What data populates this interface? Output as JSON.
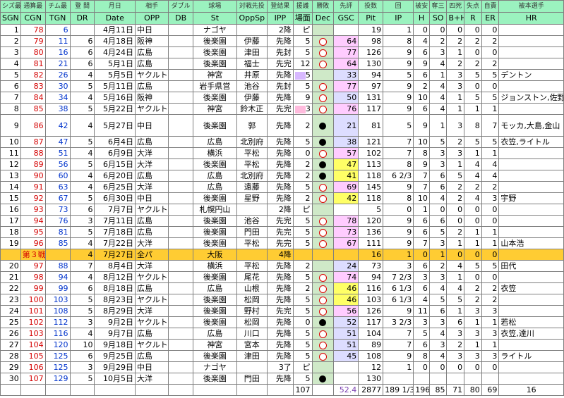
{
  "header_sub": [
    "シズ最",
    "通算最",
    "チム最",
    "登 間",
    "月日",
    "相手",
    "ダブル",
    "球場",
    "対戦先投",
    "登結果",
    "援護",
    "勝敗",
    "先評",
    "投数",
    "回",
    "被安",
    "奪三",
    "四死",
    "失点",
    "自責",
    "被本選手"
  ],
  "header_main": [
    "SGN",
    "CGN",
    "TGN",
    "DR",
    "Date",
    "OPP",
    "DB",
    "St",
    "OppSp",
    "IPP",
    "場面",
    "Dec",
    "GSC",
    "Pit",
    "IP",
    "H",
    "SO",
    "B+H",
    "R",
    "ER",
    "HR"
  ],
  "rows": [
    {
      "sgn": "1",
      "cgn": "78",
      "tgn": "6",
      "dr": "",
      "date": "4月11日",
      "opp": "中日",
      "db": "",
      "st": "ナゴヤ",
      "oppsp": "",
      "ipp": "2降",
      "scene": "ピ",
      "dec": "",
      "gsc": "",
      "pit": "19",
      "ip": "1",
      "h": "0",
      "so": "0",
      "bh": "0",
      "r": "0",
      "er": "0",
      "hr": "",
      "box": "",
      "gscc": ""
    },
    {
      "sgn": "2",
      "cgn": "79",
      "tgn": "11",
      "dr": "6",
      "date": "4月18日",
      "opp": "阪神",
      "db": "",
      "st": "後楽園",
      "oppsp": "伊藤",
      "ipp": "先降",
      "scene": "5",
      "dec": "o",
      "gsc": "64",
      "pit": "98",
      "ip": "8",
      "h": "4",
      "so": "2",
      "bh": "2",
      "r": "2",
      "er": "2",
      "hr": "",
      "box": "",
      "gscc": "pink"
    },
    {
      "sgn": "3",
      "cgn": "80",
      "tgn": "16",
      "dr": "6",
      "date": "4月24日",
      "opp": "広島",
      "db": "",
      "st": "後楽園",
      "oppsp": "津田",
      "ipp": "先封",
      "scene": "5",
      "dec": "o",
      "gsc": "77",
      "pit": "126",
      "ip": "9",
      "h": "6",
      "so": "3",
      "bh": "1",
      "r": "0",
      "er": "0",
      "hr": "",
      "box": "",
      "gscc": "pink"
    },
    {
      "sgn": "4",
      "cgn": "81",
      "tgn": "21",
      "dr": "6",
      "date": "5月1日",
      "opp": "広島",
      "db": "",
      "st": "後楽園",
      "oppsp": "福士",
      "ipp": "先完",
      "scene": "12",
      "dec": "o",
      "gsc": "64",
      "pit": "130",
      "ip": "9",
      "h": "9",
      "so": "4",
      "bh": "2",
      "r": "2",
      "er": "2",
      "hr": "",
      "box": "",
      "gscc": "pink"
    },
    {
      "sgn": "5",
      "cgn": "82",
      "tgn": "26",
      "dr": "4",
      "date": "5月5日",
      "opp": "ヤクルト",
      "db": "",
      "st": "神宮",
      "oppsp": "井原",
      "ipp": "先降",
      "scene": "5",
      "dec": "",
      "gsc": "33",
      "pit": "94",
      "ip": "5",
      "h": "6",
      "so": "1",
      "bh": "3",
      "r": "5",
      "er": "5",
      "hr": "デントン",
      "box": "lav",
      "gscc": "lav"
    },
    {
      "sgn": "6",
      "cgn": "83",
      "tgn": "30",
      "dr": "5",
      "date": "5月11日",
      "opp": "広島",
      "db": "",
      "st": "岩手県営",
      "oppsp": "池谷",
      "ipp": "先封",
      "scene": "5",
      "dec": "o",
      "gsc": "77",
      "pit": "97",
      "ip": "9",
      "h": "2",
      "so": "4",
      "bh": "3",
      "r": "0",
      "er": "0",
      "hr": "",
      "box": "",
      "gscc": "pink"
    },
    {
      "sgn": "7",
      "cgn": "84",
      "tgn": "34",
      "dr": "4",
      "date": "5月16日",
      "opp": "阪神",
      "db": "",
      "st": "後楽園",
      "oppsp": "伊藤",
      "ipp": "先降",
      "scene": "9",
      "dec": "o",
      "gsc": "50",
      "pit": "131",
      "ip": "9",
      "h": "10",
      "so": "4",
      "bh": "1",
      "r": "5",
      "er": "5",
      "hr": "ジョンストン,佐野",
      "box": "",
      "gscc": "lav"
    },
    {
      "sgn": "8",
      "cgn": "85",
      "tgn": "38",
      "dr": "5",
      "date": "5月22日",
      "opp": "ヤクルト",
      "db": "",
      "st": "神宮",
      "oppsp": "鈴木正",
      "ipp": "先完",
      "scene": "3",
      "dec": "o",
      "gsc": "76",
      "pit": "117",
      "ip": "9",
      "h": "6",
      "so": "4",
      "bh": "1",
      "r": "1",
      "er": "1",
      "hr": "",
      "box": "pink",
      "gscc": "pink"
    },
    {
      "sgn": "9",
      "cgn": "86",
      "tgn": "42",
      "dr": "4",
      "date": "5月27日",
      "opp": "中日",
      "db": "",
      "st": "後楽園",
      "oppsp": "郭",
      "ipp": "先降",
      "scene": "2",
      "dec": "x",
      "gsc": "21",
      "pit": "81",
      "ip": "5",
      "h": "9",
      "so": "1",
      "bh": "3",
      "r": "8",
      "er": "7",
      "hr": "モッカ,大島,金山",
      "box": "",
      "gscc": "lav",
      "tall": true
    },
    {
      "sgn": "10",
      "cgn": "87",
      "tgn": "47",
      "dr": "5",
      "date": "6月4日",
      "opp": "広島",
      "db": "",
      "st": "広島",
      "oppsp": "北別府",
      "ipp": "先降",
      "scene": "5",
      "dec": "x",
      "gsc": "38",
      "pit": "121",
      "ip": "7",
      "h": "10",
      "so": "5",
      "bh": "2",
      "r": "5",
      "er": "5",
      "hr": "衣笠,ライトル",
      "box": "",
      "gscc": "lav"
    },
    {
      "sgn": "11",
      "cgn": "88",
      "tgn": "51",
      "dr": "4",
      "date": "6月9日",
      "opp": "大洋",
      "db": "",
      "st": "横浜",
      "oppsp": "平松",
      "ipp": "先降",
      "scene": "0",
      "dec": "o",
      "gsc": "57",
      "pit": "102",
      "ip": "7",
      "h": "8",
      "so": "3",
      "bh": "3",
      "r": "1",
      "er": "1",
      "hr": "",
      "box": "",
      "gscc": "pink"
    },
    {
      "sgn": "12",
      "cgn": "89",
      "tgn": "56",
      "dr": "5",
      "date": "6月15日",
      "opp": "大洋",
      "db": "",
      "st": "後楽園",
      "oppsp": "平松",
      "ipp": "先降",
      "scene": "2",
      "dec": "x",
      "gsc": "47",
      "pit": "113",
      "ip": "8",
      "h": "9",
      "so": "3",
      "bh": "1",
      "r": "4",
      "er": "4",
      "hr": "",
      "box": "",
      "gscc": "yel"
    },
    {
      "sgn": "13",
      "cgn": "90",
      "tgn": "60",
      "dr": "4",
      "date": "6月20日",
      "opp": "広島",
      "db": "",
      "st": "広島",
      "oppsp": "北別府",
      "ipp": "先降",
      "scene": "2",
      "dec": "x",
      "gsc": "41",
      "pit": "118",
      "ip": "6 2/3",
      "h": "7",
      "so": "6",
      "bh": "5",
      "r": "4",
      "er": "4",
      "hr": "",
      "box": "",
      "gscc": "yel"
    },
    {
      "sgn": "14",
      "cgn": "91",
      "tgn": "63",
      "dr": "4",
      "date": "6月25日",
      "opp": "大洋",
      "db": "",
      "st": "広島",
      "oppsp": "遠藤",
      "ipp": "先降",
      "scene": "5",
      "dec": "o",
      "gsc": "69",
      "pit": "145",
      "ip": "9",
      "h": "7",
      "so": "6",
      "bh": "2",
      "r": "2",
      "er": "2",
      "hr": "",
      "box": "",
      "gscc": "pink"
    },
    {
      "sgn": "15",
      "cgn": "92",
      "tgn": "67",
      "dr": "5",
      "date": "6月30日",
      "opp": "中日",
      "db": "",
      "st": "後楽園",
      "oppsp": "星野",
      "ipp": "先降",
      "scene": "2",
      "dec": "o",
      "gsc": "42",
      "pit": "118",
      "ip": "8",
      "h": "10",
      "so": "4",
      "bh": "2",
      "r": "4",
      "er": "3",
      "hr": "宇野",
      "box": "",
      "gscc": "yel"
    },
    {
      "sgn": "16",
      "cgn": "93",
      "tgn": "73",
      "dr": "6",
      "date": "7月7日",
      "opp": "ヤクルト",
      "db": "",
      "st": "札幌円山",
      "oppsp": "",
      "ipp": "2降",
      "scene": "ピ",
      "dec": "",
      "gsc": "",
      "pit": "5",
      "ip": "0",
      "h": "1",
      "so": "0",
      "bh": "0",
      "r": "0",
      "er": "0",
      "hr": "",
      "box": "",
      "gscc": ""
    },
    {
      "sgn": "17",
      "cgn": "94",
      "tgn": "76",
      "dr": "3",
      "date": "7月11日",
      "opp": "広島",
      "db": "",
      "st": "後楽園",
      "oppsp": "池谷",
      "ipp": "先完",
      "scene": "5",
      "dec": "o",
      "gsc": "78",
      "pit": "120",
      "ip": "9",
      "h": "6",
      "so": "6",
      "bh": "0",
      "r": "0",
      "er": "0",
      "hr": "",
      "box": "",
      "gscc": "pink"
    },
    {
      "sgn": "18",
      "cgn": "95",
      "tgn": "81",
      "dr": "5",
      "date": "7月18日",
      "opp": "広島",
      "db": "",
      "st": "後楽園",
      "oppsp": "門田",
      "ipp": "先完",
      "scene": "5",
      "dec": "o",
      "gsc": "73",
      "pit": "136",
      "ip": "9",
      "h": "6",
      "so": "5",
      "bh": "2",
      "r": "1",
      "er": "1",
      "hr": "",
      "box": "",
      "gscc": "pink"
    },
    {
      "sgn": "19",
      "cgn": "96",
      "tgn": "85",
      "dr": "4",
      "date": "7月22日",
      "opp": "大洋",
      "db": "",
      "st": "後楽園",
      "oppsp": "平松",
      "ipp": "先完",
      "scene": "5",
      "dec": "o",
      "gsc": "67",
      "pit": "111",
      "ip": "9",
      "h": "7",
      "so": "3",
      "bh": "1",
      "r": "1",
      "er": "1",
      "hr": "山本浩",
      "box": "",
      "gscc": "pink"
    },
    {
      "allstar": true,
      "sgn": "",
      "cgn": "第３戦",
      "tgn": "",
      "dr": "4",
      "date": "7月27日",
      "opp": "全パ",
      "db": "",
      "st": "大阪",
      "oppsp": "",
      "ipp": "4降",
      "scene": "",
      "dec": "",
      "gsc": "",
      "pit": "16",
      "ip": "1",
      "h": "0",
      "so": "1",
      "bh": "0",
      "r": "0",
      "er": "0",
      "hr": "",
      "box": "",
      "gscc": ""
    },
    {
      "sgn": "20",
      "cgn": "97",
      "tgn": "88",
      "dr": "7",
      "date": "8月4日",
      "opp": "大洋",
      "db": "",
      "st": "横浜",
      "oppsp": "平松",
      "ipp": "先降",
      "scene": "2",
      "dec": "",
      "gsc": "24",
      "pit": "73",
      "ip": "3",
      "h": "6",
      "so": "2",
      "bh": "4",
      "r": "5",
      "er": "5",
      "hr": "田代",
      "box": "",
      "gscc": "lav"
    },
    {
      "sgn": "21",
      "cgn": "98",
      "tgn": "94",
      "dr": "4",
      "date": "8月12日",
      "opp": "ヤクルト",
      "db": "",
      "st": "後楽園",
      "oppsp": "尾花",
      "ipp": "先降",
      "scene": "5",
      "dec": "o",
      "gsc": "74",
      "pit": "94",
      "ip": "7 2/3",
      "h": "3",
      "so": "3",
      "bh": "1",
      "r": "0",
      "er": "0",
      "hr": "",
      "box": "",
      "gscc": "pink"
    },
    {
      "sgn": "22",
      "cgn": "99",
      "tgn": "99",
      "dr": "6",
      "date": "8月18日",
      "opp": "広島",
      "db": "",
      "st": "広島",
      "oppsp": "山根",
      "ipp": "先降",
      "scene": "2",
      "dec": "o",
      "gsc": "46",
      "pit": "116",
      "ip": "6 1/3",
      "h": "6",
      "so": "4",
      "bh": "4",
      "r": "2",
      "er": "2",
      "hr": "衣笠",
      "box": "",
      "gscc": "yel"
    },
    {
      "sgn": "23",
      "cgn": "100",
      "tgn": "103",
      "dr": "5",
      "date": "8月23日",
      "opp": "ヤクルト",
      "db": "",
      "st": "後楽園",
      "oppsp": "松岡",
      "ipp": "先降",
      "scene": "5",
      "dec": "o",
      "gsc": "46",
      "pit": "103",
      "ip": "6 1/3",
      "h": "4",
      "so": "5",
      "bh": "5",
      "r": "2",
      "er": "2",
      "hr": "",
      "box": "",
      "gscc": "yel"
    },
    {
      "sgn": "24",
      "cgn": "101",
      "tgn": "108",
      "dr": "5",
      "date": "8月29日",
      "opp": "大洋",
      "db": "",
      "st": "後楽園",
      "oppsp": "野村",
      "ipp": "先完",
      "scene": "5",
      "dec": "o",
      "gsc": "56",
      "pit": "126",
      "ip": "9",
      "h": "11",
      "so": "6",
      "bh": "1",
      "r": "3",
      "er": "3",
      "hr": "",
      "box": "",
      "gscc": "pink"
    },
    {
      "sgn": "25",
      "cgn": "102",
      "tgn": "112",
      "dr": "3",
      "date": "9月2日",
      "opp": "ヤクルト",
      "db": "",
      "st": "後楽園",
      "oppsp": "松岡",
      "ipp": "先降",
      "scene": "0",
      "dec": "x",
      "gsc": "52",
      "pit": "117",
      "ip": "3 2/3",
      "h": "3",
      "so": "3",
      "bh": "6",
      "r": "1",
      "er": "1",
      "hr": "若松",
      "box": "",
      "gscc": "lav"
    },
    {
      "sgn": "26",
      "cgn": "103",
      "tgn": "116",
      "dr": "4",
      "date": "9月7日",
      "opp": "広島",
      "db": "",
      "st": "広島",
      "oppsp": "川口",
      "ipp": "先降",
      "scene": "5",
      "dec": "o",
      "gsc": "51",
      "pit": "104",
      "ip": "7",
      "h": "5",
      "so": "4",
      "bh": "3",
      "r": "3",
      "er": "3",
      "hr": "衣笠,達川",
      "box": "",
      "gscc": "lav"
    },
    {
      "sgn": "27",
      "cgn": "104",
      "tgn": "120",
      "dr": "10",
      "date": "9月18日",
      "opp": "ヤクルト",
      "db": "",
      "st": "神宮",
      "oppsp": "宮本",
      "ipp": "先降",
      "scene": "5",
      "dec": "o",
      "gsc": "51",
      "pit": "89",
      "ip": "7",
      "h": "6",
      "so": "3",
      "bh": "2",
      "r": "1",
      "er": "1",
      "hr": "",
      "box": "",
      "gscc": "lav"
    },
    {
      "sgn": "28",
      "cgn": "105",
      "tgn": "125",
      "dr": "6",
      "date": "9月25日",
      "opp": "広島",
      "db": "",
      "st": "後楽園",
      "oppsp": "津田",
      "ipp": "先降",
      "scene": "5",
      "dec": "o",
      "gsc": "45",
      "pit": "108",
      "ip": "9",
      "h": "8",
      "so": "4",
      "bh": "3",
      "r": "3",
      "er": "3",
      "hr": "ライトル",
      "box": "",
      "gscc": "lav"
    },
    {
      "sgn": "29",
      "cgn": "106",
      "tgn": "125",
      "dr": "3",
      "date": "9月29日",
      "opp": "中日",
      "db": "",
      "st": "ナゴヤ",
      "oppsp": "",
      "ipp": "3了",
      "scene": "ピ",
      "dec": "",
      "gsc": "",
      "pit": "12",
      "ip": "1",
      "h": "0",
      "so": "0",
      "bh": "0",
      "r": "0",
      "er": "0",
      "hr": "",
      "box": "",
      "gscc": ""
    },
    {
      "sgn": "30",
      "cgn": "107",
      "tgn": "129",
      "dr": "5",
      "date": "10月5日",
      "opp": "大洋",
      "db": "",
      "st": "後楽園",
      "oppsp": "門田",
      "ipp": "先降",
      "scene": "5",
      "dec": "x",
      "gsc": "",
      "pit": "130",
      "ip": "",
      "h": "",
      "so": "",
      "bh": "",
      "r": "",
      "er": "",
      "hr": "",
      "box": "",
      "gscc": ""
    }
  ],
  "totals": {
    "scene": "107",
    "gsc": "52.4",
    "pit": "2877",
    "ip": "189 1/3",
    "h": "196",
    "so": "85",
    "bh": "71",
    "r": "80",
    "er": "69",
    "hr": "16"
  }
}
